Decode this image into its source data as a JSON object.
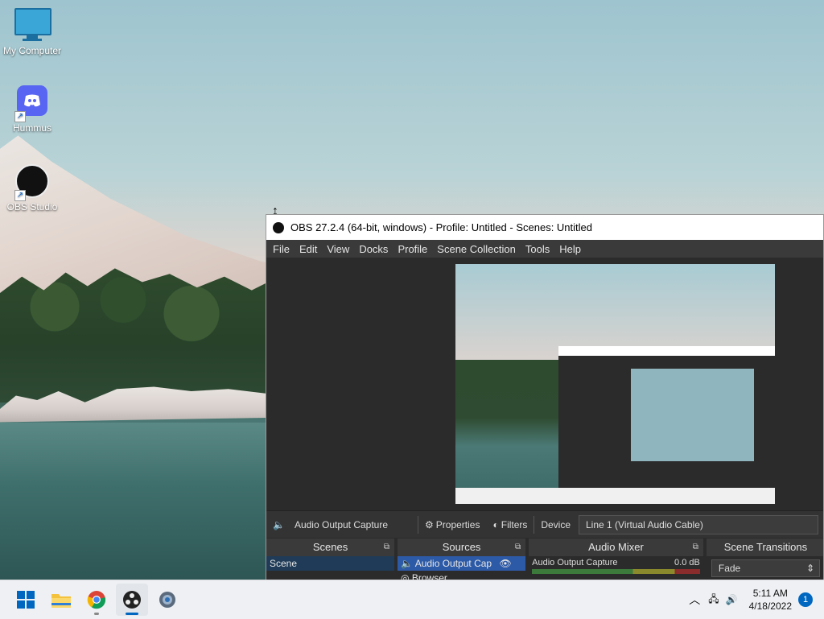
{
  "desktop": {
    "icons": [
      {
        "label": "My Computer"
      },
      {
        "label": "Hummus"
      },
      {
        "label": "OBS Studio"
      }
    ]
  },
  "obs": {
    "title": "OBS 27.2.4 (64-bit, windows) - Profile: Untitled - Scenes: Untitled",
    "menu": [
      "File",
      "Edit",
      "View",
      "Docks",
      "Profile",
      "Scene Collection",
      "Tools",
      "Help"
    ],
    "control_bar": {
      "source_name": "Audio Output Capture",
      "properties_label": "Properties",
      "filters_label": "Filters",
      "device_label": "Device",
      "device_value": "Line 1 (Virtual Audio Cable)"
    },
    "docks": {
      "scenes": {
        "title": "Scenes",
        "items": [
          "Scene"
        ]
      },
      "sources": {
        "title": "Sources",
        "items": [
          "Audio Output Cap",
          "Browser"
        ]
      },
      "mixer": {
        "title": "Audio Mixer",
        "track_name": "Audio Output Capture",
        "track_level": "0.0 dB"
      },
      "transitions": {
        "title": "Scene Transitions",
        "selected": "Fade"
      }
    }
  },
  "taskbar": {
    "apps": [
      "start-icon",
      "file-explorer-icon",
      "chrome-icon",
      "obs-icon",
      "settings-icon"
    ],
    "time": "5:11 AM",
    "date": "4/18/2022",
    "notification_count": "1"
  }
}
